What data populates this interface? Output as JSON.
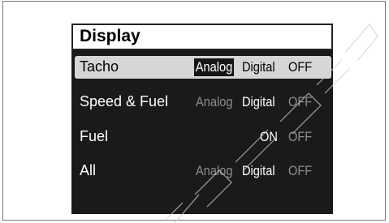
{
  "menu": {
    "title": "Display",
    "rows": [
      {
        "label": "Tacho",
        "selected": true,
        "options": [
          "Analog",
          "Digital",
          "OFF"
        ],
        "selected_option": "Analog"
      },
      {
        "label": "Speed & Fuel",
        "selected": false,
        "options": [
          "Analog",
          "Digital",
          "OFF"
        ],
        "selected_option": "Digital"
      },
      {
        "label": "Fuel",
        "selected": false,
        "options": [
          "ON",
          "OFF"
        ],
        "selected_option": "ON"
      },
      {
        "label": "All",
        "selected": false,
        "options": [
          "Analog",
          "Digital",
          "OFF"
        ],
        "selected_option": "Digital"
      }
    ]
  },
  "colors": {
    "screen_bg": "#1b1a1a",
    "highlight": "#d6d6d6",
    "active_text": "#ffffff",
    "inactive_text": "#8e8e8e"
  }
}
